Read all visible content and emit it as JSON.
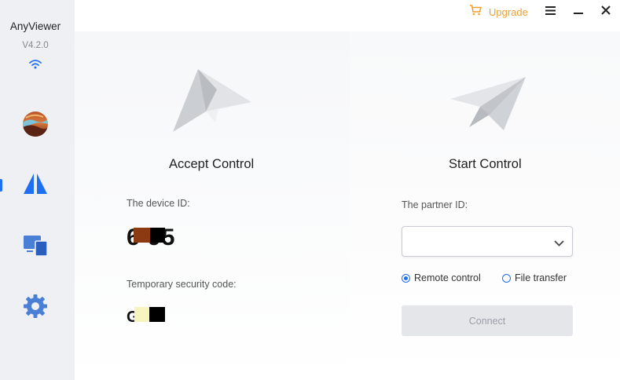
{
  "app": {
    "title": "AnyViewer",
    "version": "V4.2.0"
  },
  "header": {
    "upgrade_label": "Upgrade"
  },
  "nav": {
    "items": [
      {
        "name": "avatar"
      },
      {
        "name": "remote-control",
        "active": true
      },
      {
        "name": "devices"
      },
      {
        "name": "settings"
      }
    ]
  },
  "accept": {
    "title": "Accept Control",
    "device_id_label": "The device ID:",
    "device_id_value": "6          95",
    "security_code_label": "Temporary security code:",
    "security_code_value": "G"
  },
  "start": {
    "title": "Start Control",
    "partner_id_label": "The partner ID:",
    "partner_id_value": "",
    "options": [
      {
        "label": "Remote control",
        "selected": true
      },
      {
        "label": "File transfer",
        "selected": false
      }
    ],
    "connect_label": "Connect"
  },
  "colors": {
    "accent": "#1f6ff2",
    "upgrade": "#f0a030",
    "sidebar_bg": "#eef0f4"
  }
}
